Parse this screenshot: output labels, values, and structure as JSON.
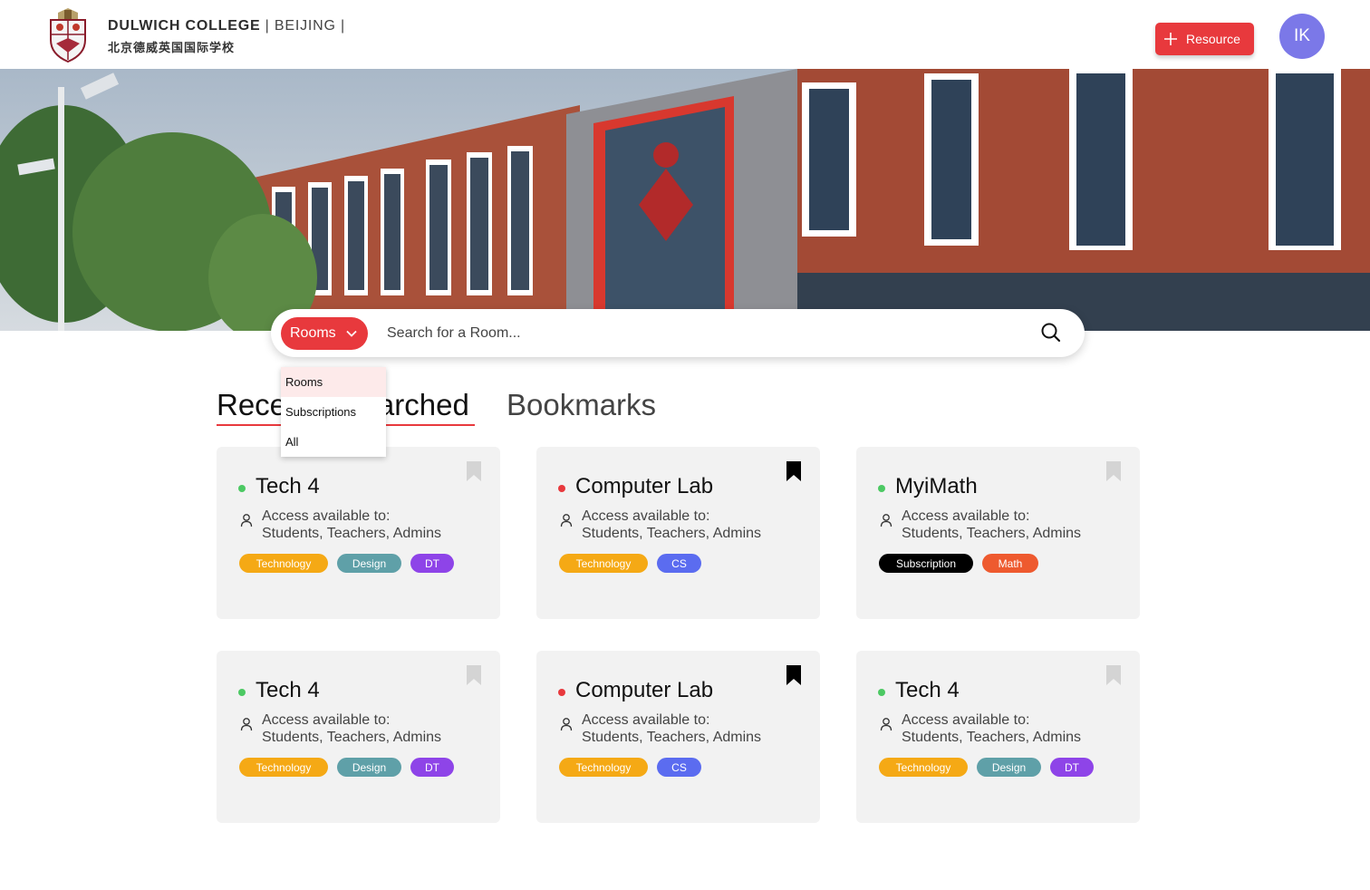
{
  "header": {
    "brand_name": "DULWICH COLLEGE",
    "brand_location": " | BEIJING |",
    "brand_chinese": "北京德威英国国际学校",
    "resource_button": "Resource",
    "avatar_initials": "IK"
  },
  "search": {
    "filter_selected": "Rooms",
    "placeholder": "Search for a Room...",
    "dropdown_options": [
      "Rooms",
      "Subscriptions",
      "All"
    ]
  },
  "tabs": {
    "recent": "Recently Searched",
    "bookmarks": "Bookmarks"
  },
  "colors": {
    "accent": "#e8393d",
    "available": "#4cc963",
    "unavailable": "#e8393d",
    "avatar": "#7b78e8"
  },
  "cards": [
    {
      "title": "Tech 4",
      "status": "available",
      "bookmarked": false,
      "access_label": "Access available to:",
      "access_value": "Students, Teachers, Admins",
      "tags": [
        {
          "label": "Technology",
          "color": "#f5a915"
        },
        {
          "label": "Design",
          "color": "#5fa0a8"
        },
        {
          "label": "DT",
          "color": "#8e44e8"
        }
      ]
    },
    {
      "title": "Computer Lab",
      "status": "unavailable",
      "bookmarked": true,
      "access_label": "Access available to:",
      "access_value": "Students, Teachers, Admins",
      "tags": [
        {
          "label": "Technology",
          "color": "#f5a915"
        },
        {
          "label": "CS",
          "color": "#5b6cf0"
        }
      ]
    },
    {
      "title": "MyiMath",
      "status": "available",
      "bookmarked": false,
      "access_label": "Access available to:",
      "access_value": "Students, Teachers, Admins",
      "tags": [
        {
          "label": "Subscription",
          "color": "#000000"
        },
        {
          "label": "Math",
          "color": "#ee5a2f"
        }
      ]
    },
    {
      "title": "Tech 4",
      "status": "available",
      "bookmarked": false,
      "access_label": "Access available to:",
      "access_value": "Students, Teachers, Admins",
      "tags": [
        {
          "label": "Technology",
          "color": "#f5a915"
        },
        {
          "label": "Design",
          "color": "#5fa0a8"
        },
        {
          "label": "DT",
          "color": "#8e44e8"
        }
      ]
    },
    {
      "title": "Computer Lab",
      "status": "unavailable",
      "bookmarked": true,
      "access_label": "Access available to:",
      "access_value": "Students, Teachers, Admins",
      "tags": [
        {
          "label": "Technology",
          "color": "#f5a915"
        },
        {
          "label": "CS",
          "color": "#5b6cf0"
        }
      ]
    },
    {
      "title": "Tech 4",
      "status": "available",
      "bookmarked": false,
      "access_label": "Access available to:",
      "access_value": "Students, Teachers, Admins",
      "tags": [
        {
          "label": "Technology",
          "color": "#f5a915"
        },
        {
          "label": "Design",
          "color": "#5fa0a8"
        },
        {
          "label": "DT",
          "color": "#8e44e8"
        }
      ]
    }
  ]
}
